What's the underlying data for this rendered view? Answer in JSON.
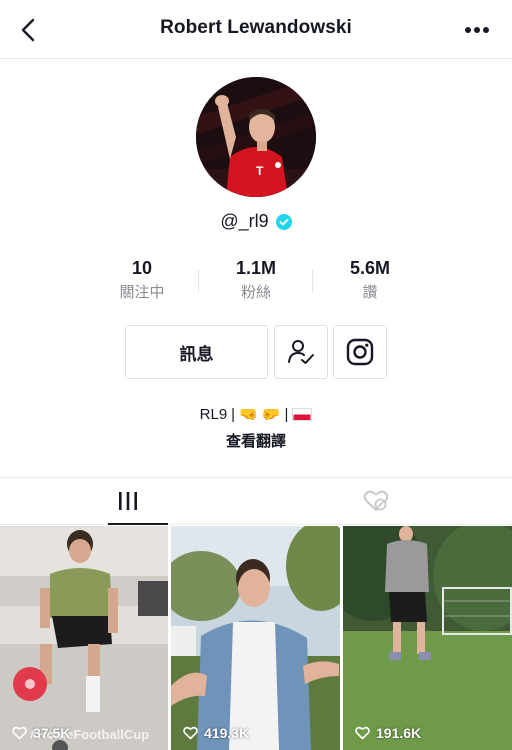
{
  "header": {
    "title": "Robert Lewandowski",
    "back_icon": "chevron-left-icon",
    "more_icon": "more-dots-icon"
  },
  "profile": {
    "handle": "@_rl9",
    "verified": true,
    "verified_color": "#20d5ec"
  },
  "stats": [
    {
      "value": "10",
      "label": "關注中"
    },
    {
      "value": "1.1M",
      "label": "粉絲"
    },
    {
      "value": "5.6M",
      "label": "讚"
    }
  ],
  "actions": {
    "message_label": "訊息",
    "follow_icon": "user-check-icon",
    "instagram_icon": "instagram-icon"
  },
  "bio": {
    "text": "RL9",
    "separator": "|",
    "translate_label": "查看翻譯"
  },
  "tabs": [
    {
      "name": "videos",
      "icon": "grid-icon",
      "active": true
    },
    {
      "name": "liked",
      "icon": "heart-hidden-icon",
      "active": false
    }
  ],
  "videos": [
    {
      "count": "37.5K",
      "overlay": "#HomeFootballCup"
    },
    {
      "count": "419.3K"
    },
    {
      "count": "191.6K"
    }
  ]
}
